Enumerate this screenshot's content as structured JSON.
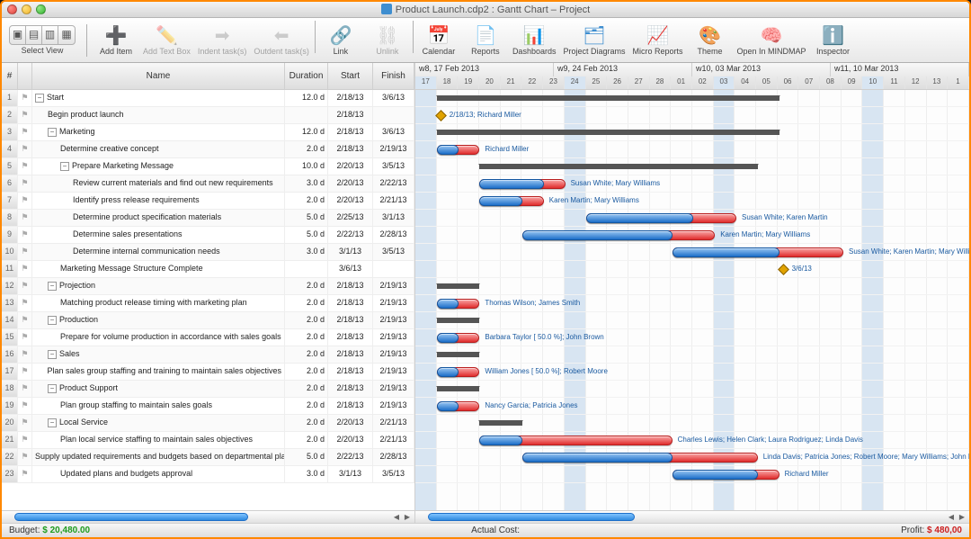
{
  "window_title": "Product Launch.cdp2 : Gantt Chart – Project",
  "toolbox": {
    "select_view": "Select View",
    "items": [
      {
        "id": "add-item",
        "label": "Add Item",
        "icon": "➕",
        "color": "#2fa82f"
      },
      {
        "id": "add-text-box",
        "label": "Add Text Box",
        "icon": "✏️",
        "color": "#999",
        "disabled": true
      },
      {
        "id": "indent",
        "label": "Indent task(s)",
        "icon": "➡",
        "color": "#999",
        "disabled": true
      },
      {
        "id": "outdent",
        "label": "Outdent task(s)",
        "icon": "⬅",
        "color": "#999",
        "disabled": true
      },
      {
        "id": "link",
        "label": "Link",
        "icon": "🔗",
        "color": "#e04db2"
      },
      {
        "id": "unlink",
        "label": "Unlink",
        "icon": "⛓",
        "color": "#999",
        "disabled": true
      },
      {
        "id": "calendar",
        "label": "Calendar",
        "icon": "📅",
        "color": "#3e8ed0"
      },
      {
        "id": "reports",
        "label": "Reports",
        "icon": "📄",
        "color": "#3e8ed0"
      },
      {
        "id": "dashboards",
        "label": "Dashboards",
        "icon": "📊",
        "color": "#3e8ed0"
      },
      {
        "id": "project-diagrams",
        "label": "Project Diagrams",
        "icon": "🗂",
        "color": "#3e8ed0"
      },
      {
        "id": "micro-reports",
        "label": "Micro Reports",
        "icon": "📈",
        "color": "#3e8ed0"
      },
      {
        "id": "theme",
        "label": "Theme",
        "icon": "🎨",
        "color": "#d07a3e"
      },
      {
        "id": "open-mindmap",
        "label": "Open In MINDMAP",
        "icon": "🧠",
        "color": "#2fa82f"
      },
      {
        "id": "inspector",
        "label": "Inspector",
        "icon": "ℹ️",
        "color": "#2d9fe0"
      }
    ]
  },
  "columns": {
    "idx": "#",
    "name": "Name",
    "duration": "Duration",
    "start": "Start",
    "finish": "Finish"
  },
  "weeks": [
    "w8, 17 Feb 2013",
    "w9, 24 Feb 2013",
    "w10, 03 Mar 2013",
    "w11, 10 Mar 2013"
  ],
  "days": [
    "17",
    "18",
    "19",
    "20",
    "21",
    "22",
    "23",
    "24",
    "25",
    "26",
    "27",
    "28",
    "01",
    "02",
    "03",
    "04",
    "05",
    "06",
    "07",
    "08",
    "09",
    "10",
    "11",
    "12",
    "13",
    "1"
  ],
  "sundayIdx": [
    0,
    7,
    14,
    21
  ],
  "dayW": 23.8,
  "timelineStartDay": 17,
  "tasks": [
    {
      "n": 1,
      "ind": 0,
      "g": true,
      "name": "Start",
      "dur": "12.0 d",
      "s": "2/18/13",
      "f": "3/6/13",
      "bar": {
        "t": "sum",
        "a": 1,
        "b": 17
      }
    },
    {
      "n": 2,
      "ind": 1,
      "name": "Begin product launch",
      "dur": "",
      "s": "2/18/13",
      "f": "",
      "bar": {
        "t": "ms",
        "a": 1
      },
      "cap": "2/18/13; Richard Miller"
    },
    {
      "n": 3,
      "ind": 1,
      "g": true,
      "name": "Marketing",
      "dur": "12.0 d",
      "s": "2/18/13",
      "f": "3/6/13",
      "bar": {
        "t": "sum",
        "a": 1,
        "b": 17
      }
    },
    {
      "n": 4,
      "ind": 2,
      "name": "Determine creative concept",
      "dur": "2.0 d",
      "s": "2/18/13",
      "f": "2/19/13",
      "bars": [
        {
          "t": "red",
          "a": 1,
          "b": 3
        },
        {
          "t": "blue",
          "a": 1,
          "b": 2
        }
      ],
      "cap": "Richard Miller"
    },
    {
      "n": 5,
      "ind": 2,
      "g": true,
      "name": "Prepare Marketing Message",
      "dur": "10.0 d",
      "s": "2/20/13",
      "f": "3/5/13",
      "bar": {
        "t": "sum",
        "a": 3,
        "b": 16
      }
    },
    {
      "n": 6,
      "ind": 3,
      "name": "Review current materials and find out new requirements",
      "dur": "3.0 d",
      "s": "2/20/13",
      "f": "2/22/13",
      "bars": [
        {
          "t": "red",
          "a": 3,
          "b": 7
        },
        {
          "t": "blue",
          "a": 3,
          "b": 6
        }
      ],
      "cap": "Susan White; Mary Williams"
    },
    {
      "n": 7,
      "ind": 3,
      "name": "Identify press release requirements",
      "dur": "2.0 d",
      "s": "2/20/13",
      "f": "2/21/13",
      "bars": [
        {
          "t": "red",
          "a": 3,
          "b": 6
        },
        {
          "t": "blue",
          "a": 3,
          "b": 5
        }
      ],
      "cap": "Karen Martin; Mary Williams"
    },
    {
      "n": 8,
      "ind": 3,
      "name": "Determine product specification materials",
      "dur": "5.0 d",
      "s": "2/25/13",
      "f": "3/1/13",
      "bars": [
        {
          "t": "red",
          "a": 8,
          "b": 15
        },
        {
          "t": "blue",
          "a": 8,
          "b": 13
        }
      ],
      "cap": "Susan White; Karen Martin"
    },
    {
      "n": 9,
      "ind": 3,
      "name": "Determine sales presentations",
      "dur": "5.0 d",
      "s": "2/22/13",
      "f": "2/28/13",
      "bars": [
        {
          "t": "red",
          "a": 5,
          "b": 14
        },
        {
          "t": "blue",
          "a": 5,
          "b": 12
        }
      ],
      "cap": "Karen Martin; Mary Williams"
    },
    {
      "n": 10,
      "ind": 3,
      "name": "Determine internal communication needs",
      "dur": "3.0 d",
      "s": "3/1/13",
      "f": "3/5/13",
      "bars": [
        {
          "t": "red",
          "a": 12,
          "b": 20
        },
        {
          "t": "blue",
          "a": 12,
          "b": 17
        }
      ],
      "cap": "Susan White; Karen Martin; Mary Williams"
    },
    {
      "n": 11,
      "ind": 2,
      "name": "Marketing Message Structure Complete",
      "dur": "",
      "s": "3/6/13",
      "f": "",
      "bar": {
        "t": "ms",
        "a": 17
      },
      "cap": "3/6/13"
    },
    {
      "n": 12,
      "ind": 1,
      "g": true,
      "name": "Projection",
      "dur": "2.0 d",
      "s": "2/18/13",
      "f": "2/19/13",
      "bar": {
        "t": "sum",
        "a": 1,
        "b": 3
      }
    },
    {
      "n": 13,
      "ind": 2,
      "name": "Matching product release timing with marketing plan",
      "dur": "2.0 d",
      "s": "2/18/13",
      "f": "2/19/13",
      "bars": [
        {
          "t": "red",
          "a": 1,
          "b": 3
        },
        {
          "t": "blue",
          "a": 1,
          "b": 2
        }
      ],
      "cap": "Thomas Wilson; James Smith"
    },
    {
      "n": 14,
      "ind": 1,
      "g": true,
      "name": "Production",
      "dur": "2.0 d",
      "s": "2/18/13",
      "f": "2/19/13",
      "bar": {
        "t": "sum",
        "a": 1,
        "b": 3
      }
    },
    {
      "n": 15,
      "ind": 2,
      "name": "Prepare for volume production in accordance with sales goals",
      "dur": "2.0 d",
      "s": "2/18/13",
      "f": "2/19/13",
      "bars": [
        {
          "t": "red",
          "a": 1,
          "b": 3
        },
        {
          "t": "blue",
          "a": 1,
          "b": 2
        }
      ],
      "cap": "Barbara Taylor [ 50.0 %]; John Brown"
    },
    {
      "n": 16,
      "ind": 1,
      "g": true,
      "name": "Sales",
      "dur": "2.0 d",
      "s": "2/18/13",
      "f": "2/19/13",
      "bar": {
        "t": "sum",
        "a": 1,
        "b": 3
      }
    },
    {
      "n": 17,
      "ind": 2,
      "name": "Plan sales group staffing and training to maintain sales objectives",
      "dur": "2.0 d",
      "s": "2/18/13",
      "f": "2/19/13",
      "bars": [
        {
          "t": "red",
          "a": 1,
          "b": 3
        },
        {
          "t": "blue",
          "a": 1,
          "b": 2
        }
      ],
      "cap": "William Jones [ 50.0 %]; Robert Moore"
    },
    {
      "n": 18,
      "ind": 1,
      "g": true,
      "name": "Product Support",
      "dur": "2.0 d",
      "s": "2/18/13",
      "f": "2/19/13",
      "bar": {
        "t": "sum",
        "a": 1,
        "b": 3
      }
    },
    {
      "n": 19,
      "ind": 2,
      "name": "Plan group staffing to maintain sales goals",
      "dur": "2.0 d",
      "s": "2/18/13",
      "f": "2/19/13",
      "bars": [
        {
          "t": "red",
          "a": 1,
          "b": 3
        },
        {
          "t": "blue",
          "a": 1,
          "b": 2
        }
      ],
      "cap": "Nancy Garcia; Patricia Jones"
    },
    {
      "n": 20,
      "ind": 1,
      "g": true,
      "name": "Local Service",
      "dur": "2.0 d",
      "s": "2/20/13",
      "f": "2/21/13",
      "bar": {
        "t": "sum",
        "a": 3,
        "b": 5
      }
    },
    {
      "n": 21,
      "ind": 2,
      "name": "Plan local service staffing to maintain sales objectives",
      "dur": "2.0 d",
      "s": "2/20/13",
      "f": "2/21/13",
      "bars": [
        {
          "t": "red",
          "a": 3,
          "b": 12
        },
        {
          "t": "blue",
          "a": 3,
          "b": 5
        }
      ],
      "cap": "Charles Lewis; Helen Clark; Laura Rodriguez; Linda Davis"
    },
    {
      "n": 22,
      "ind": 2,
      "name": "Supply updated requirements and budgets based on departmental plans",
      "dur": "5.0 d",
      "s": "2/22/13",
      "f": "2/28/13",
      "bars": [
        {
          "t": "red",
          "a": 5,
          "b": 16
        },
        {
          "t": "blue",
          "a": 5,
          "b": 12
        }
      ],
      "cap": "Linda Davis; Patricia Jones; Robert Moore; Mary Williams; John Brown; James Smith"
    },
    {
      "n": 23,
      "ind": 2,
      "name": "Updated plans and budgets approval",
      "dur": "3.0 d",
      "s": "3/1/13",
      "f": "3/5/13",
      "bars": [
        {
          "t": "red",
          "a": 12,
          "b": 17
        },
        {
          "t": "blue",
          "a": 12,
          "b": 16
        }
      ],
      "cap": "Richard Miller"
    }
  ],
  "status": {
    "budget_label": "Budget:",
    "budget_val": "$ 20,480.00",
    "actual_label": "Actual Cost:",
    "profit_label": "Profit:",
    "profit_val": "$ 480,00"
  },
  "chart_data": {
    "type": "gantt",
    "title": "Product Launch – Gantt Chart",
    "date_start": "2013-02-17",
    "date_end": "2013-03-14",
    "tasks_ref": "tasks"
  }
}
